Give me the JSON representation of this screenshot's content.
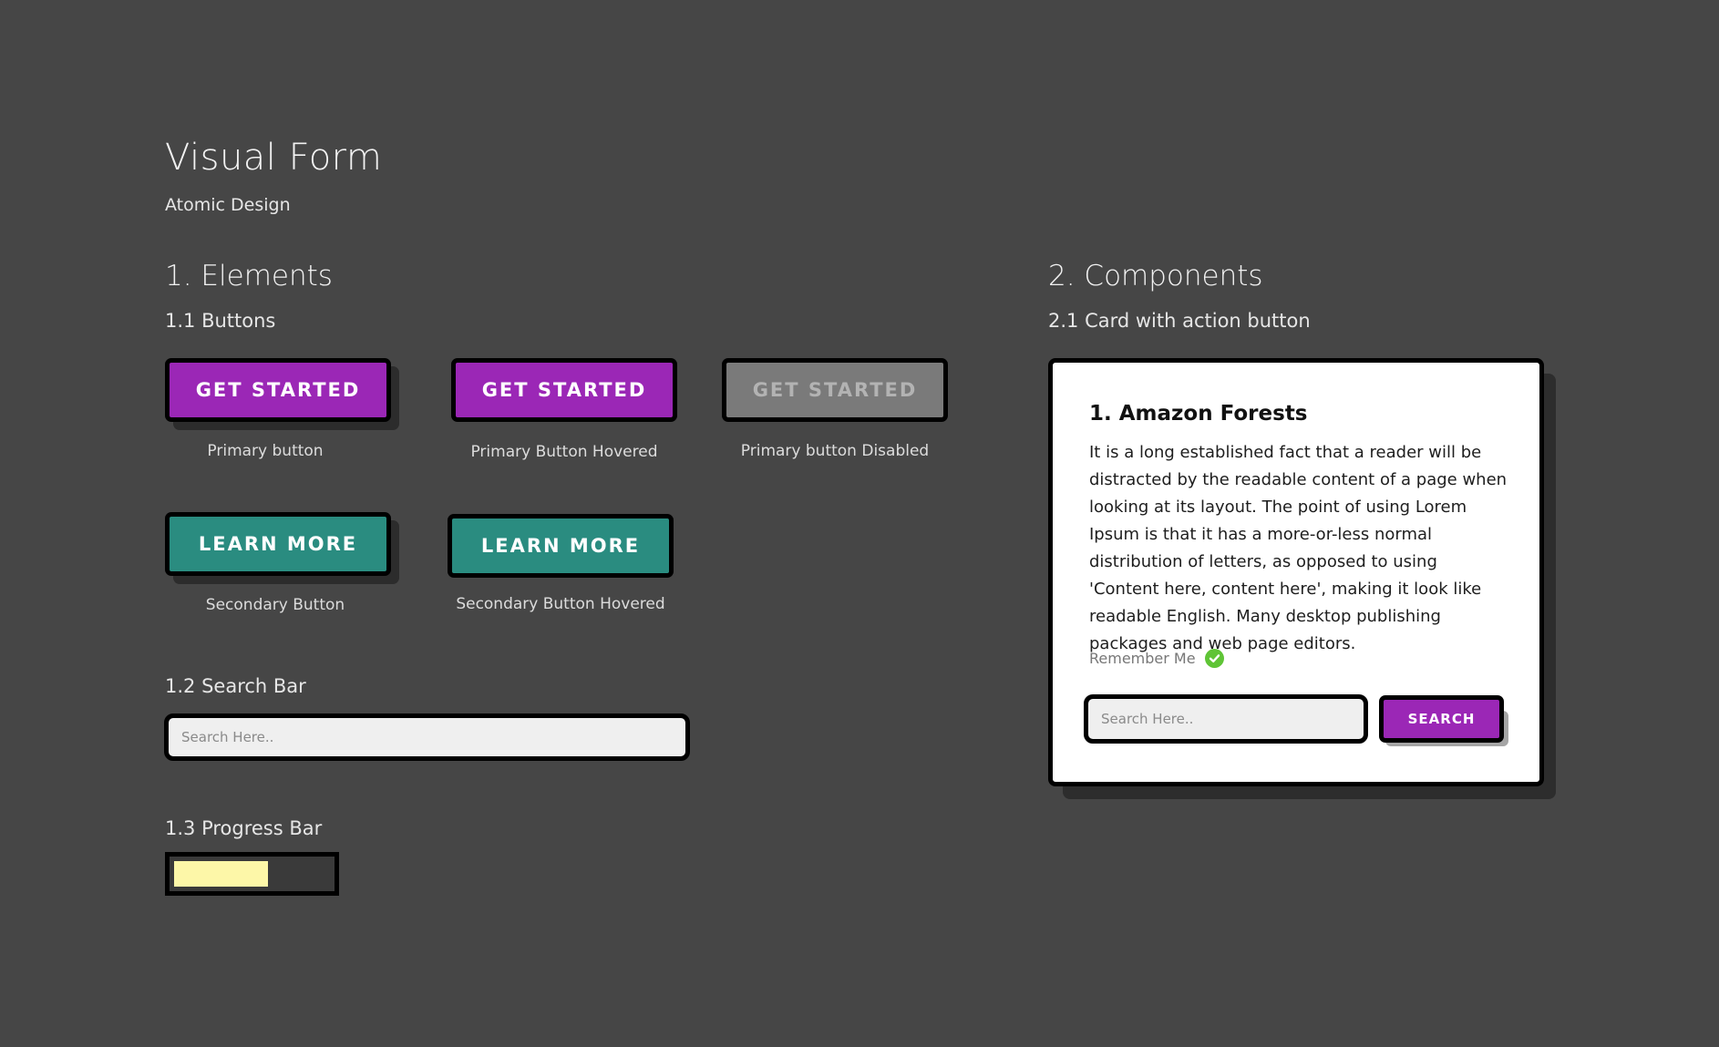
{
  "header": {
    "title": "Visual Form",
    "subtitle": "Atomic Design"
  },
  "elements": {
    "title": "1. Elements",
    "buttons": {
      "title": "1.1 Buttons",
      "primary": {
        "label": "GET STARTED",
        "caption": "Primary button"
      },
      "primary_hovered": {
        "label": "GET STARTED",
        "caption": "Primary Button Hovered"
      },
      "primary_disabled": {
        "label": "GET STARTED",
        "caption": "Primary button Disabled"
      },
      "secondary": {
        "label": "LEARN MORE",
        "caption": "Secondary Button"
      },
      "secondary_hovered": {
        "label": "LEARN MORE",
        "caption": "Secondary Button Hovered"
      }
    },
    "search_bar": {
      "title": "1.2 Search Bar",
      "placeholder": "Search Here.."
    },
    "progress_bar": {
      "title": "1.3 Progress Bar",
      "value_percent": 60
    }
  },
  "components": {
    "title": "2. Components",
    "card_section_title": "2.1 Card with action button",
    "card": {
      "title": "1. Amazon Forests",
      "body": "It is a long established fact that a reader will be distracted by the readable content of a page when looking at its layout. The point of using Lorem Ipsum is that it has a more-or-less normal distribution of letters, as opposed to using 'Content here, content here', making it look like readable English. Many desktop publishing packages and web page editors.",
      "remember_label": "Remember Me",
      "search_placeholder": "Search Here..",
      "search_button": "SEARCH"
    }
  },
  "colors": {
    "background": "#464646",
    "primary": "#9b27b6",
    "secondary": "#2a8c80",
    "disabled": "#7a7a7a",
    "progress": "#fdf7a8",
    "check": "#5fc436"
  },
  "icons": {
    "remember_check": "check-circle-icon"
  }
}
